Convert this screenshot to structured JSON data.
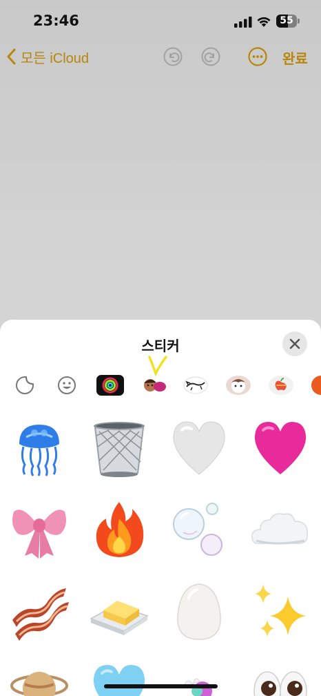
{
  "status_bar": {
    "time": "23:46",
    "battery_level": 55,
    "battery_label": "55"
  },
  "toolbar": {
    "back_label": "모든 iCloud",
    "done_label": "완료",
    "accent_color": "#b8860b"
  },
  "sticker_sheet": {
    "title": "스티커",
    "categories": [
      {
        "icon": "sticker-peel-icon"
      },
      {
        "icon": "emoji-face-icon"
      },
      {
        "icon": "activity-rings-icon"
      },
      {
        "icon": "memoji-sticker-icon",
        "selected": true
      },
      {
        "icon": "cat-sketch-sticker-icon"
      },
      {
        "icon": "pet-sticker-icon"
      },
      {
        "icon": "apple-logo-sticker-icon"
      },
      {
        "icon": "orange-app-sticker-icon"
      }
    ],
    "stickers": [
      "jellyfish",
      "wastebasket",
      "white-heart",
      "pink-heart",
      "ribbon-bow",
      "fire",
      "bubbles",
      "cloud",
      "bacon",
      "butter",
      "egg",
      "sparkles",
      "ringed-planet",
      "light-blue-heart",
      "soap-bubble",
      "eyes"
    ]
  }
}
